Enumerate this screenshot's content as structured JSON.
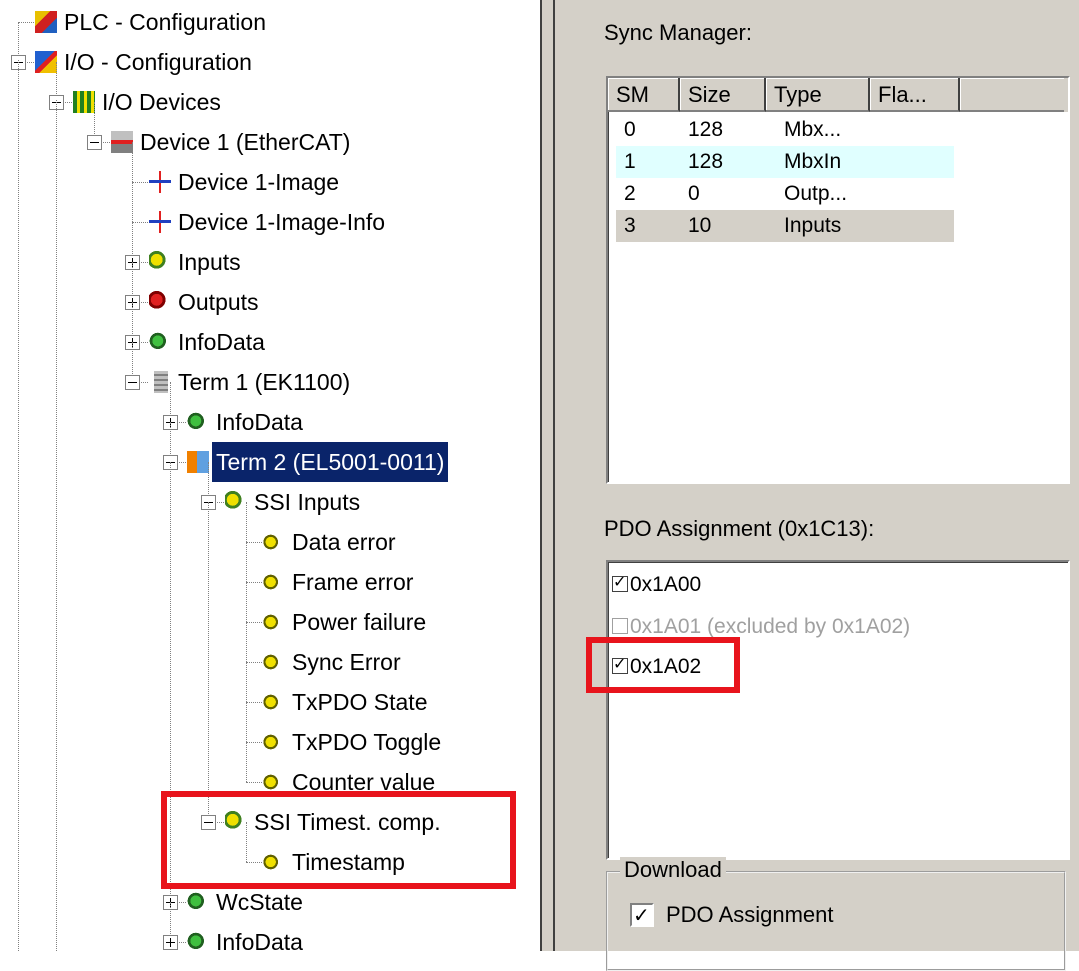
{
  "tree": {
    "nodes": [
      {
        "label": "PLC - Configuration",
        "icon": "plc-config-icon",
        "expand": "none"
      },
      {
        "label": "I/O - Configuration",
        "icon": "io-config-icon",
        "expand": "minus"
      },
      {
        "label": "I/O Devices",
        "icon": "io-devices-icon",
        "expand": "minus"
      },
      {
        "label": "Device 1 (EtherCAT)",
        "icon": "ethercat-device-icon",
        "expand": "minus"
      },
      {
        "label": "Device 1-Image",
        "icon": "image-icon",
        "expand": "none"
      },
      {
        "label": "Device 1-Image-Info",
        "icon": "image-icon",
        "expand": "none"
      },
      {
        "label": "Inputs",
        "icon": "inputs-icon",
        "expand": "plus"
      },
      {
        "label": "Outputs",
        "icon": "outputs-icon",
        "expand": "plus"
      },
      {
        "label": "InfoData",
        "icon": "infodata-icon",
        "expand": "plus"
      },
      {
        "label": "Term 1 (EK1100)",
        "icon": "terminal-icon",
        "expand": "minus"
      },
      {
        "label": "InfoData",
        "icon": "infodata-icon",
        "expand": "plus"
      },
      {
        "label": "Term 2 (EL5001-0011)",
        "icon": "terminal-module-icon",
        "expand": "minus",
        "selected": true
      },
      {
        "label": "SSI Inputs",
        "icon": "inputs-icon",
        "expand": "minus"
      },
      {
        "label": "Data error",
        "icon": "variable-input-icon",
        "expand": "none"
      },
      {
        "label": "Frame error",
        "icon": "variable-input-icon",
        "expand": "none"
      },
      {
        "label": "Power failure",
        "icon": "variable-input-icon",
        "expand": "none"
      },
      {
        "label": "Sync Error",
        "icon": "variable-input-icon",
        "expand": "none"
      },
      {
        "label": "TxPDO State",
        "icon": "variable-input-icon",
        "expand": "none"
      },
      {
        "label": "TxPDO Toggle",
        "icon": "variable-input-icon",
        "expand": "none"
      },
      {
        "label": "Counter value",
        "icon": "variable-input-icon",
        "expand": "none"
      },
      {
        "label": "SSI Timest. comp.",
        "icon": "inputs-icon",
        "expand": "minus"
      },
      {
        "label": "Timestamp",
        "icon": "variable-input-icon",
        "expand": "none"
      },
      {
        "label": "WcState",
        "icon": "infodata-icon",
        "expand": "plus"
      },
      {
        "label": "InfoData",
        "icon": "infodata-icon",
        "expand": "plus"
      }
    ]
  },
  "sync_manager": {
    "caption": "Sync Manager:",
    "columns": [
      "SM",
      "Size",
      "Type",
      "Fla..."
    ],
    "rows": [
      {
        "sm": "0",
        "size": "128",
        "type": "Mbx..."
      },
      {
        "sm": "1",
        "size": "128",
        "type": "MbxIn"
      },
      {
        "sm": "2",
        "size": "0",
        "type": "Outp..."
      },
      {
        "sm": "3",
        "size": "10",
        "type": "Inputs"
      }
    ]
  },
  "pdo_assignment": {
    "caption": "PDO Assignment (0x1C13):",
    "items": [
      {
        "label": "0x1A00",
        "checked": true,
        "enabled": true
      },
      {
        "label": "0x1A01 (excluded by 0x1A02)",
        "checked": false,
        "enabled": false
      },
      {
        "label": "0x1A02",
        "checked": true,
        "enabled": true
      }
    ]
  },
  "download": {
    "legend": "Download",
    "options": [
      {
        "label": "PDO Assignment",
        "checked": true
      }
    ]
  },
  "colors": {
    "selection": "#0a246a",
    "highlight": "#e8141c",
    "panel": "#d4d0c8",
    "row_hover": "#e0ffff",
    "row_selected": "#d4d0c8"
  }
}
